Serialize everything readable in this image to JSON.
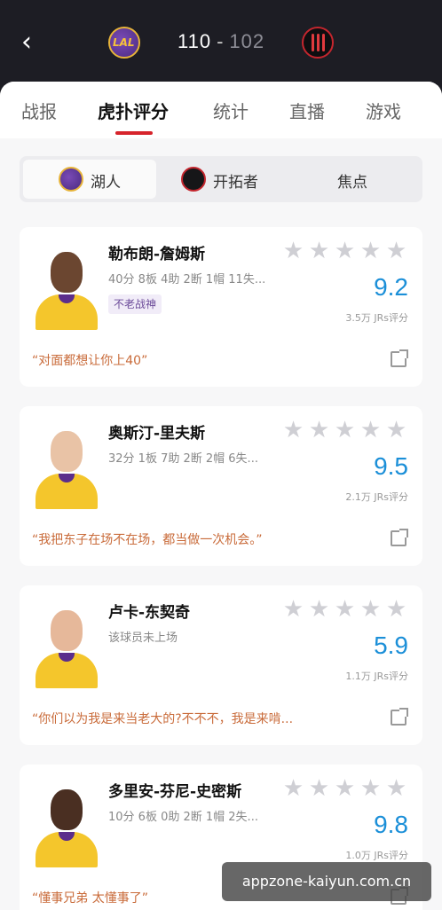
{
  "header": {
    "home_logo_text": "LAL",
    "home_score": "110",
    "separator": "-",
    "away_score": "102"
  },
  "tabs": [
    {
      "label": "战报"
    },
    {
      "label": "虎扑评分"
    },
    {
      "label": "统计"
    },
    {
      "label": "直播"
    },
    {
      "label": "游戏"
    }
  ],
  "subtabs": [
    {
      "label": "湖人"
    },
    {
      "label": "开拓者"
    },
    {
      "label": "焦点"
    }
  ],
  "players": [
    {
      "name": "勒布朗-詹姆斯",
      "stats": "40分 8板 4助 2断 1帽 11失...",
      "tag": "不老战神",
      "rating": "9.2",
      "votes": "3.5万 JRs评分",
      "quote": "“对面都想让你上40”"
    },
    {
      "name": "奥斯汀-里夫斯",
      "stats": "32分 1板 7助 2断 2帽 6失...",
      "tag": "",
      "rating": "9.5",
      "votes": "2.1万 JRs评分",
      "quote": "“我把东子在场不在场，都当做一次机会。”"
    },
    {
      "name": "卢卡-东契奇",
      "stats": "该球员未上场",
      "tag": "",
      "rating": "5.9",
      "votes": "1.1万 JRs评分",
      "quote": "“你们以为我是来当老大的?不不不，我是来啃..."
    },
    {
      "name": "多里安-芬尼-史密斯",
      "stats": "10分 6板 0助 2断 1帽 2失...",
      "tag": "",
      "rating": "9.8",
      "votes": "1.0万 JRs评分",
      "quote": "“懂事兄弟 太懂事了”"
    }
  ],
  "stars_count": 5,
  "watermark": "appzone-kaiyun.com.cn",
  "colors": {
    "accent_red": "#d6232b",
    "rating_blue": "#1b8fd8",
    "quote_orange": "#c96b3a",
    "lakers_gold": "#f4c62c",
    "lakers_purple": "#5b2d8c"
  },
  "icons": {
    "back": "chevron-left-icon",
    "star": "star-icon",
    "share": "share-icon"
  }
}
